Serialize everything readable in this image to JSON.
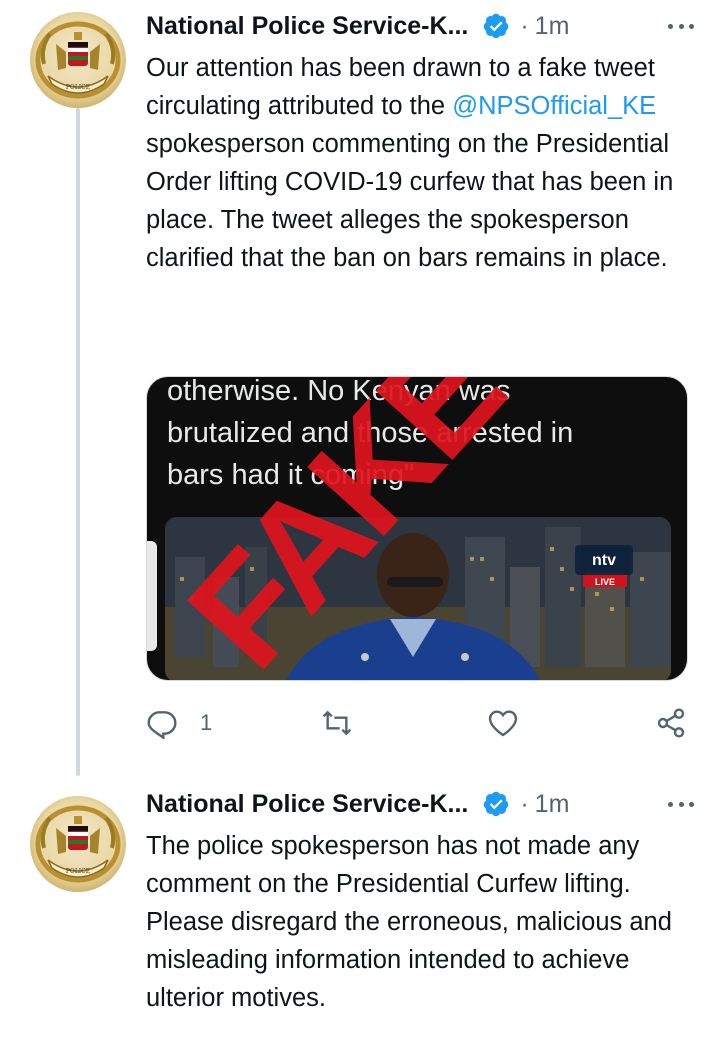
{
  "colors": {
    "accent": "#1d9bf0",
    "text": "#0f1419",
    "secondary": "#536471",
    "line": "#cfd9de",
    "fake_stamp": "#e0141e"
  },
  "tweets": [
    {
      "author": "National Police Service-K...",
      "verified": true,
      "separator": "·",
      "time": "1m",
      "text_before": "Our attention has been drawn to a fake tweet circulating attributed to the ",
      "mention": "@NPSOfficial_KE",
      "text_after": " spokesperson commenting on the Presidential Order lifting COVID-19 curfew that has been in place. The tweet alleges the spokesperson clarified that the ban on bars remains in place.",
      "media": {
        "caption": "otherwise. No Kenyan was\nbrutalized and those arrested in\nbars had it coming\"",
        "stamp": "FAKE",
        "channel_logo": "ntv",
        "channel_badge": "LIVE"
      },
      "actions": {
        "reply_count": "1",
        "reply_icon": "reply-icon",
        "retweet_icon": "retweet-icon",
        "like_icon": "heart-icon",
        "share_icon": "share-icon"
      }
    },
    {
      "author": "National Police Service-K...",
      "verified": true,
      "separator": "·",
      "time": "1m",
      "text": "The police spokesperson has not made any comment on the Presidential Curfew lifting. Please disregard the erroneous, malicious and misleading information intended to achieve ulterior motives."
    }
  ]
}
